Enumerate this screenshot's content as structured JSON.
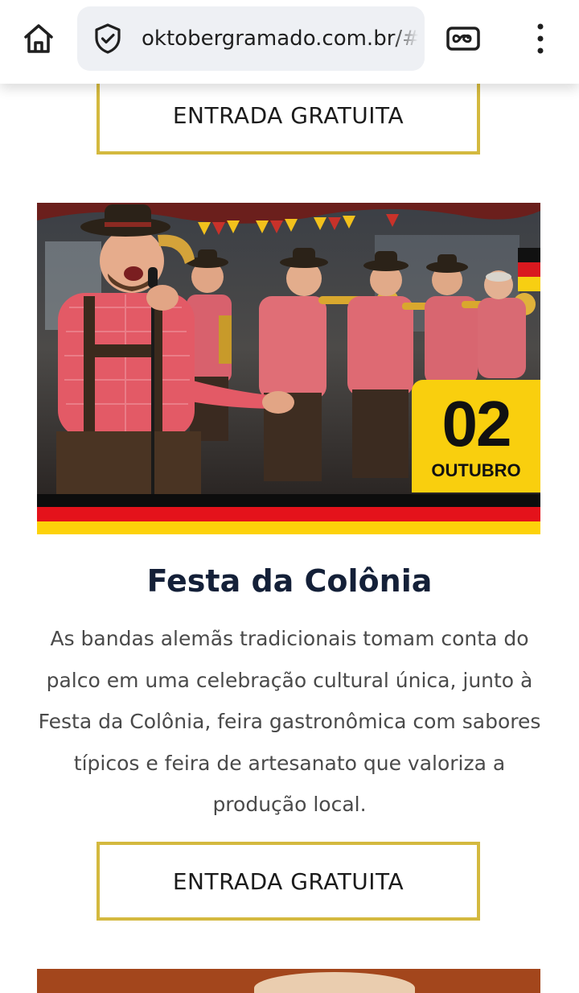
{
  "browser": {
    "url": "oktobergramado.com.br/#",
    "icons": {
      "home": "home-icon",
      "security": "shield-check-icon",
      "tabs": "incognito-tabs-icon",
      "menu": "more-vert-icon"
    }
  },
  "cta_top": {
    "label": "ENTRADA GRATUITA"
  },
  "event": {
    "date": {
      "day": "02",
      "month": "OUTUBRO"
    },
    "title": "Festa da Colônia",
    "description": "As bandas alemãs tradicionais tomam conta do palco em uma celebração cultural única, junto à Festa da Colônia, feira gastronômica com sabores típicos e feira de artesanato que valoriza a produção local.",
    "cta_label": "ENTRADA GRATUITA"
  },
  "colors": {
    "accent_border": "#d4b93f",
    "title": "#142038",
    "text": "#4a4a4a",
    "badge": "#f9cf0e",
    "flag_black": "#0d0d0d",
    "flag_red": "#e4121b",
    "flag_gold": "#fdd20a"
  }
}
